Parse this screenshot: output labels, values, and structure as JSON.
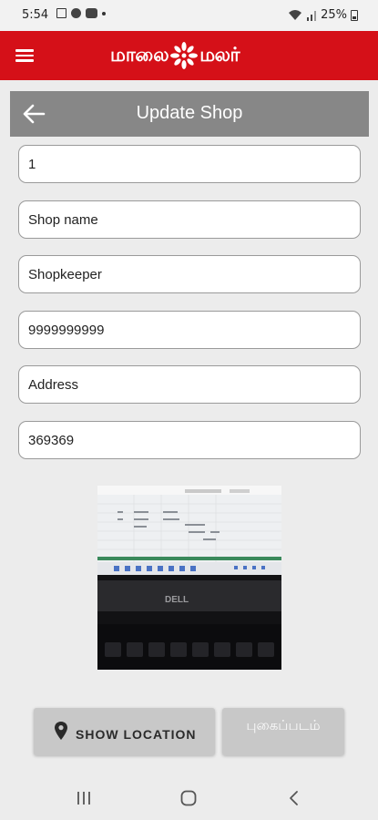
{
  "status_bar": {
    "time": "5:54",
    "battery": "25%"
  },
  "app_bar": {
    "logo_left": "மாலை",
    "logo_right": "மலர்",
    "brand_color": "#d51018"
  },
  "header": {
    "title": "Update Shop"
  },
  "form": {
    "shop_id": "1",
    "shop_name": "Shop name",
    "shopkeeper": "Shopkeeper",
    "phone": "9999999999",
    "address": "Address",
    "pincode": "369369"
  },
  "buttons": {
    "show_location": "SHOW LOCATION",
    "photo": "புகைப்படம்"
  },
  "icons": {
    "menu": "hamburger-menu-icon",
    "back": "back-arrow-icon",
    "location": "location-pin-icon",
    "nav_recents": "recents-icon",
    "nav_home": "home-icon",
    "nav_back": "back-chevron-icon"
  }
}
